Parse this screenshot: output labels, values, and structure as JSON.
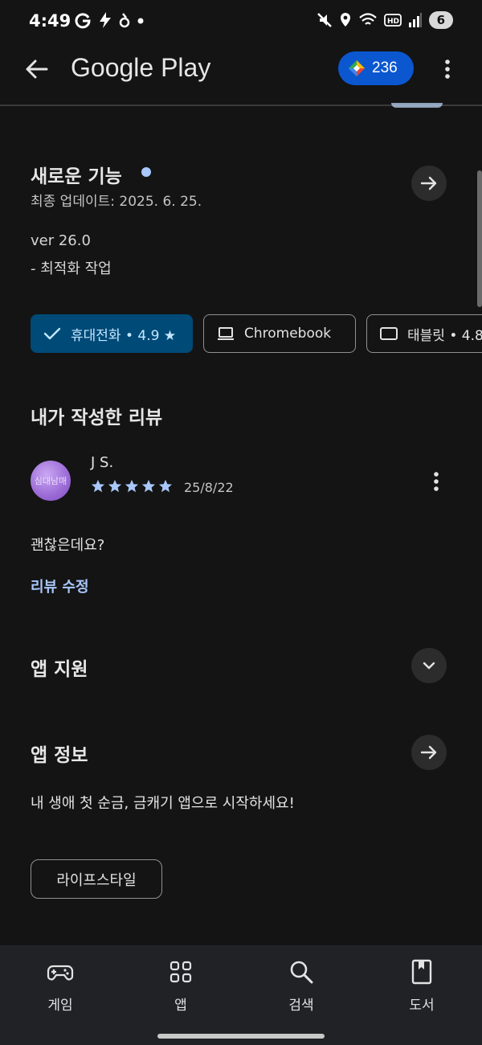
{
  "status_bar": {
    "time": "4:49",
    "battery_level": "6"
  },
  "app_bar": {
    "title": "Google Play",
    "points": "236"
  },
  "whats_new": {
    "title": "새로운 기능",
    "updated": "최종 업데이트: 2025. 6. 25.",
    "version": "ver 26.0",
    "note": "- 최적화 작업"
  },
  "device_chips": [
    {
      "label": "휴대전화 • 4.9 ★",
      "selected": true,
      "icon": "check-icon"
    },
    {
      "label": "Chromebook",
      "selected": false,
      "icon": "laptop-icon"
    },
    {
      "label": "태블릿 • 4.8",
      "selected": false,
      "icon": "tablet-icon"
    }
  ],
  "my_review": {
    "title": "내가 작성한 리뷰",
    "reviewer": "J S.",
    "avatar_text": "심대남매",
    "stars": 5,
    "date": "25/8/22",
    "body": "괜찮은데요?",
    "edit_label": "리뷰 수정"
  },
  "app_support": {
    "title": "앱 지원"
  },
  "app_info": {
    "title": "앱 정보",
    "description": "내 생애 첫 순금, 금캐기 앱으로 시작하세요!",
    "category": "라이프스타일"
  },
  "bottom_nav": [
    {
      "label": "게임",
      "icon": "gamepad-icon"
    },
    {
      "label": "앱",
      "icon": "apps-grid-icon"
    },
    {
      "label": "검색",
      "icon": "search-icon"
    },
    {
      "label": "도서",
      "icon": "book-icon"
    }
  ],
  "colors": {
    "background": "#141414",
    "accent_blue": "#0b57d0",
    "link_blue": "#a8c7fa",
    "selected_chip": "#004a77"
  }
}
